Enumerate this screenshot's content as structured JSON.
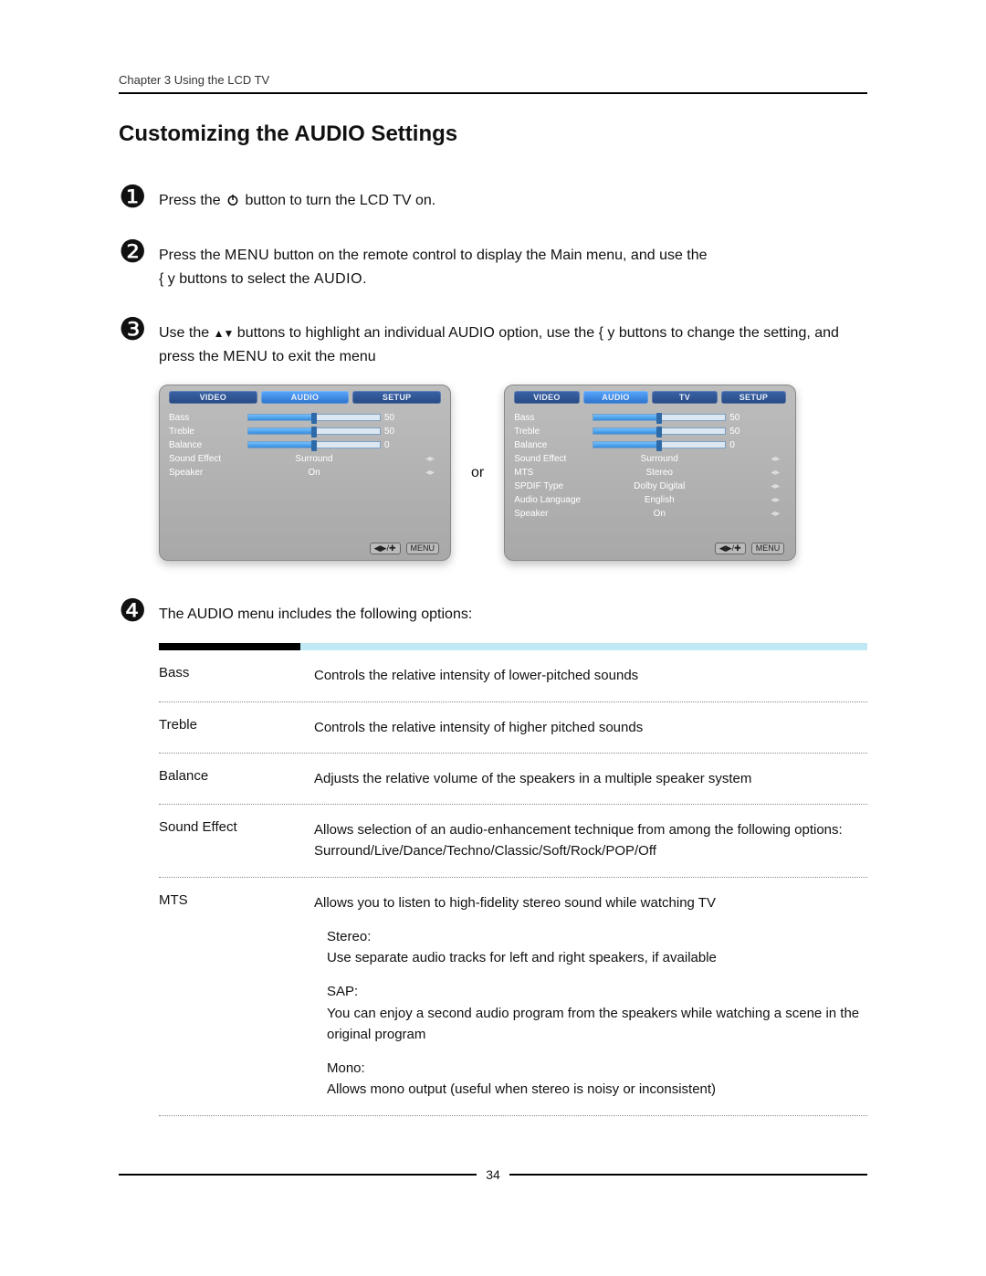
{
  "header": {
    "running": "Chapter 3 Using the LCD TV"
  },
  "title": "Customizing the AUDIO Settings",
  "steps": {
    "s1": {
      "bullet": "❶",
      "pre": "Press the ",
      "post": " button to turn the LCD TV on."
    },
    "s2": {
      "bullet": "❷",
      "line1_pre": "Press the ",
      "menu": "MENU",
      "line1_post": " button on the remote control to display the Main menu, and use the ",
      "line2_pre": "{ y   buttons to select the ",
      "audio": "AUDIO",
      "line2_post": "."
    },
    "s3": {
      "bullet": "❸",
      "pre": "Use the  ",
      "arrows": "▲▼",
      "mid1": " buttons to highlight an individual AUDIO option, use the  { y   buttons to change the setting, and press the ",
      "menu": "MENU",
      "post": " to exit the menu"
    },
    "s4": {
      "bullet": "❹",
      "text": "The AUDIO menu includes the following options:"
    }
  },
  "osd_common": {
    "or": "or",
    "footer": {
      "nav": "◀▶/✚",
      "menu": "MENU"
    }
  },
  "osd_left": {
    "tabs": [
      "VIDEO",
      "AUDIO",
      "SETUP"
    ],
    "activeTab": 1,
    "rows": [
      {
        "label": "Bass",
        "type": "slider",
        "value": 50,
        "pct": 50
      },
      {
        "label": "Treble",
        "type": "slider",
        "value": 50,
        "pct": 50
      },
      {
        "label": "Balance",
        "type": "slider",
        "value": 0,
        "pct": 50
      },
      {
        "label": "Sound Effect",
        "type": "enum",
        "value": "Surround"
      },
      {
        "label": "Speaker",
        "type": "enum",
        "value": "On"
      }
    ]
  },
  "osd_right": {
    "tabs": [
      "VIDEO",
      "AUDIO",
      "TV",
      "SETUP"
    ],
    "activeTab": 1,
    "rows": [
      {
        "label": "Bass",
        "type": "slider",
        "value": 50,
        "pct": 50
      },
      {
        "label": "Treble",
        "type": "slider",
        "value": 50,
        "pct": 50
      },
      {
        "label": "Balance",
        "type": "slider",
        "value": 0,
        "pct": 50
      },
      {
        "label": "Sound Effect",
        "type": "enum",
        "value": "Surround"
      },
      {
        "label": "MTS",
        "type": "enum",
        "value": "Stereo"
      },
      {
        "label": "SPDIF Type",
        "type": "enum",
        "value": "Dolby Digital"
      },
      {
        "label": "Audio Language",
        "type": "enum",
        "value": "English"
      },
      {
        "label": "Speaker",
        "type": "enum",
        "value": "On"
      }
    ]
  },
  "options": [
    {
      "term": "Bass",
      "desc": "Controls the relative intensity of lower-pitched sounds"
    },
    {
      "term": "Treble",
      "desc": "Controls the relative intensity of higher pitched sounds"
    },
    {
      "term": "Balance",
      "desc": "Adjusts the relative volume of the speakers in a multiple speaker system"
    },
    {
      "term": "Sound Effect",
      "desc": "Allows selection of an audio-enhancement technique from among the following options: Surround/Live/Dance/Techno/Classic/Soft/Rock/POP/Off"
    },
    {
      "term": "MTS",
      "desc": "Allows you to listen to high-fidelity stereo sound while watching TV",
      "subs": [
        {
          "title": "Stereo:",
          "body": "Use separate audio tracks for left and right speakers, if available"
        },
        {
          "title": "SAP:",
          "body": "You can enjoy a second audio program from the speakers while watching a scene in the original program"
        },
        {
          "title": "Mono:",
          "body": "Allows mono output (useful when stereo is noisy or inconsistent)"
        }
      ]
    }
  ],
  "pageNumber": "34"
}
